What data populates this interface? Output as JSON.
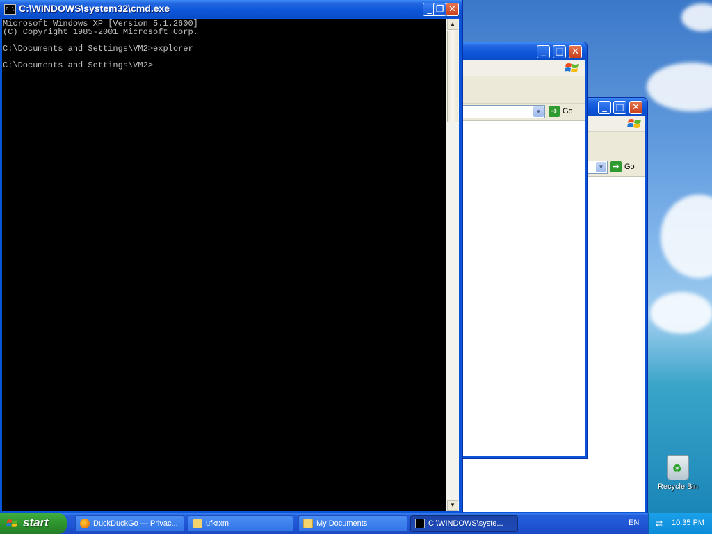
{
  "cmd": {
    "title": "C:\\WINDOWS\\system32\\cmd.exe",
    "lines": [
      "Microsoft Windows XP [Version 5.1.2600]",
      "(C) Copyright 1985-2001 Microsoft Corp.",
      "",
      "C:\\Documents and Settings\\VM2>explorer",
      "",
      "C:\\Documents and Settings\\VM2>"
    ]
  },
  "explorer_windows": [
    {
      "go_label": "Go"
    },
    {
      "go_label": "Go"
    }
  ],
  "desktop": {
    "recycle_bin_label": "Recycle Bin"
  },
  "taskbar": {
    "start_label": "start",
    "buttons": [
      {
        "label": "DuckDuckGo — Privac...",
        "icon": "firefox-icon"
      },
      {
        "label": "ufkrxm",
        "icon": "folder-icon"
      },
      {
        "label": "My Documents",
        "icon": "folder-icon"
      },
      {
        "label": "C:\\WINDOWS\\syste...",
        "icon": "cmd-icon"
      }
    ],
    "language": "EN",
    "clock": "10:35 PM"
  },
  "colors": {
    "titlebar": "#0a54d8",
    "start_green": "#2b8f2b",
    "console_bg": "#000000",
    "console_text": "#c0c0c0"
  }
}
